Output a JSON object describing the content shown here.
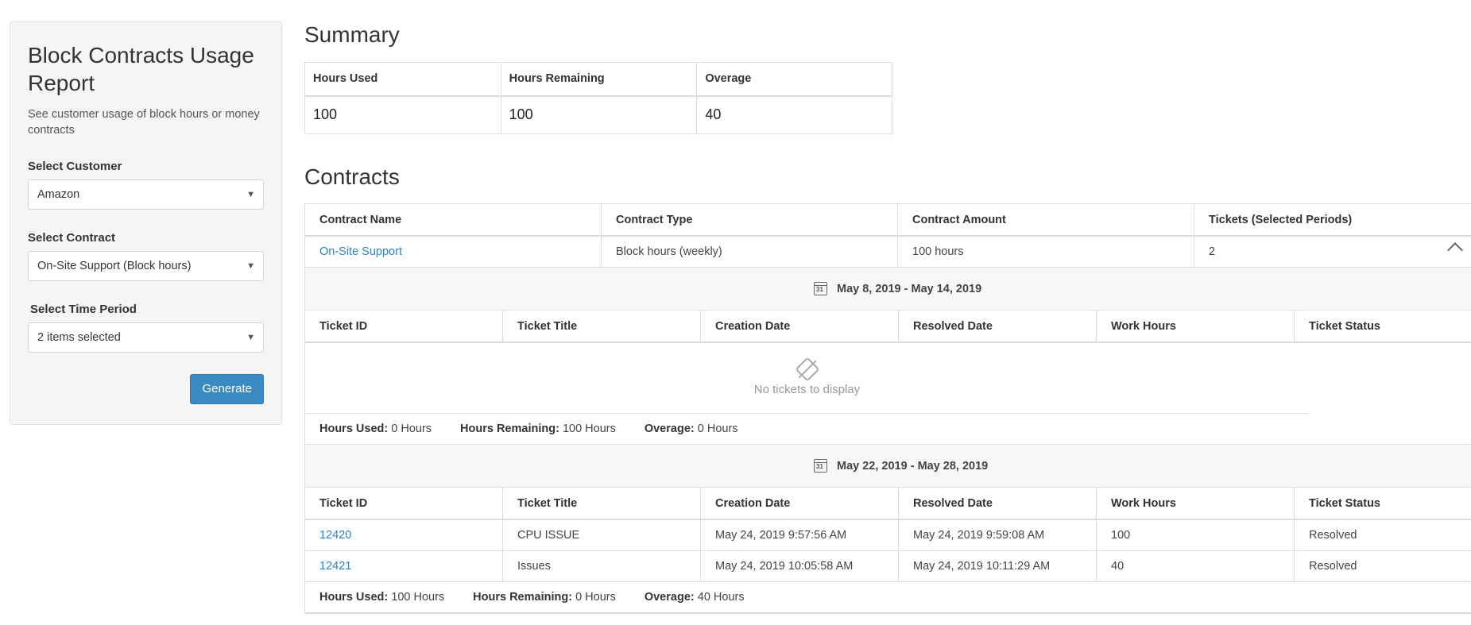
{
  "sidebar": {
    "title": "Block Contracts Usage Report",
    "description": "See customer usage of block hours or money contracts",
    "customer_label": "Select Customer",
    "customer_value": "Amazon",
    "contract_label": "Select Contract",
    "contract_value": "On-Site Support (Block hours)",
    "period_label": "Select Time Period",
    "period_value": "2 items selected",
    "generate_label": "Generate"
  },
  "summary": {
    "title": "Summary",
    "headers": [
      "Hours Used",
      "Hours Remaining",
      "Overage"
    ],
    "values": [
      "100",
      "100",
      "40"
    ]
  },
  "contracts": {
    "title": "Contracts",
    "headers": [
      "Contract Name",
      "Contract Type",
      "Contract Amount",
      "Tickets (Selected Periods)"
    ],
    "row": {
      "name": "On-Site Support",
      "type": "Block hours (weekly)",
      "amount": "100 hours",
      "tickets": "2"
    },
    "ticket_headers": [
      "Ticket ID",
      "Ticket Title",
      "Creation Date",
      "Resolved Date",
      "Work Hours",
      "Ticket Status"
    ],
    "periods": [
      {
        "range": "May 8, 2019 - May 14, 2019",
        "empty_text": "No tickets to display",
        "tickets": [],
        "hours_used_label": "Hours Used:",
        "hours_used": "0 Hours",
        "hours_remaining_label": "Hours Remaining:",
        "hours_remaining": "100 Hours",
        "overage_label": "Overage:",
        "overage": "0 Hours"
      },
      {
        "range": "May 22, 2019 - May 28, 2019",
        "tickets": [
          {
            "id": "12420",
            "title": "CPU ISSUE",
            "created": "May 24, 2019 9:57:56 AM",
            "resolved": "May 24, 2019 9:59:08 AM",
            "hours": "100",
            "status": "Resolved"
          },
          {
            "id": "12421",
            "title": "Issues",
            "created": "May 24, 2019 10:05:58 AM",
            "resolved": "May 24, 2019 10:11:29 AM",
            "hours": "40",
            "status": "Resolved"
          }
        ],
        "hours_used_label": "Hours Used:",
        "hours_used": "100 Hours",
        "hours_remaining_label": "Hours Remaining:",
        "hours_remaining": "0 Hours",
        "overage_label": "Overage:",
        "overage": "40 Hours"
      }
    ]
  },
  "icons": {
    "calendar_day": "31"
  }
}
